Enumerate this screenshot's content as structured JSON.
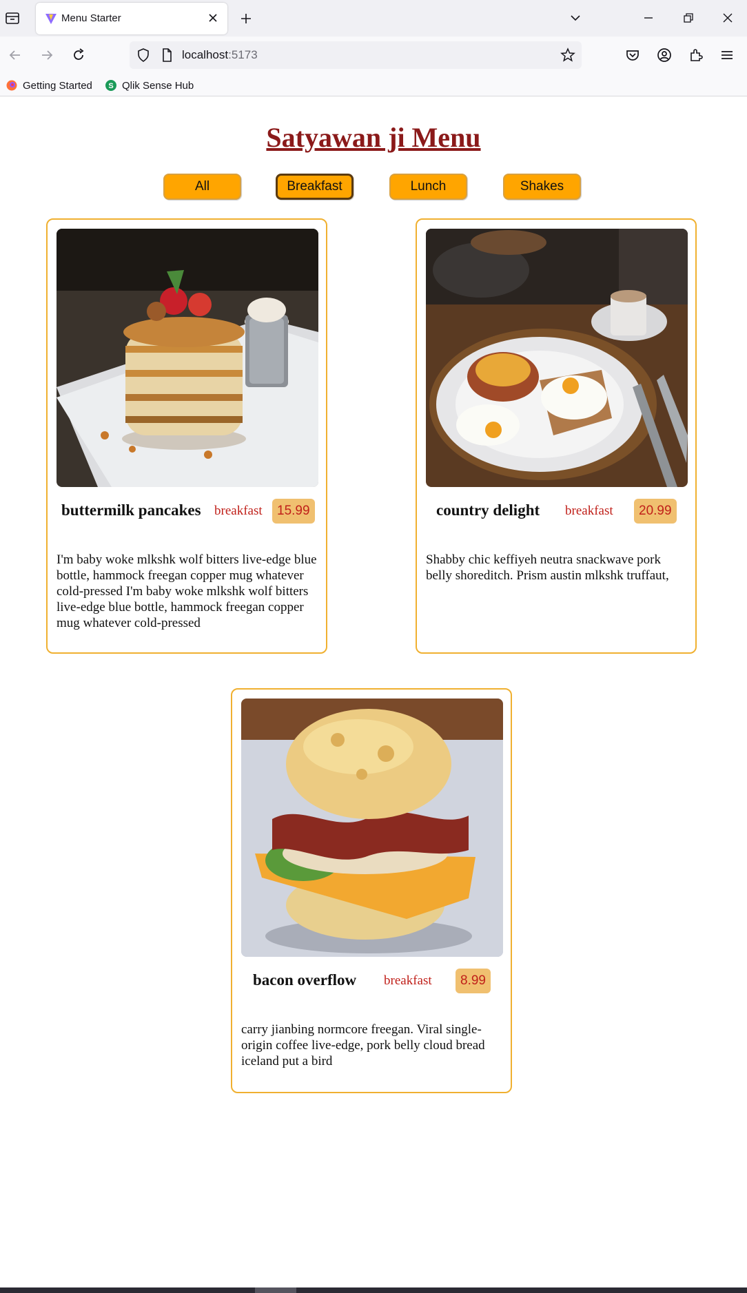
{
  "browser": {
    "tab_title": "Menu Starter",
    "url_host": "localhost",
    "url_port": ":5173",
    "bookmarks": [
      "Getting Started",
      "Qlik Sense Hub"
    ]
  },
  "page": {
    "title": "Satyawan ji Menu",
    "filters": [
      "All",
      "Breakfast",
      "Lunch",
      "Shakes"
    ],
    "active_filter": "Breakfast"
  },
  "items": [
    {
      "name": "buttermilk pancakes",
      "category": "breakfast",
      "price": "15.99",
      "image_icon": "pancakes-photo",
      "description": "I'm baby woke mlkshk wolf bitters live-edge blue bottle, hammock freegan copper mug whatever cold-pressed I'm baby woke mlkshk wolf bitters live-edge blue bottle, hammock freegan copper mug whatever cold-pressed"
    },
    {
      "name": "country delight",
      "category": "breakfast",
      "price": "20.99",
      "image_icon": "eggs-toast-photo",
      "description": "Shabby chic keffiyeh neutra snackwave pork belly shoreditch. Prism austin mlkshk truffaut,"
    },
    {
      "name": "bacon overflow",
      "category": "breakfast",
      "price": "8.99",
      "image_icon": "biscuit-sandwich-photo",
      "description": "carry jianbing normcore freegan. Viral single-origin coffee live-edge, pork belly cloud bread iceland put a bird"
    }
  ],
  "colors": {
    "title": "#8b1a1a",
    "button": "#ffa500",
    "card_border": "#f0b030",
    "price_bg": "#f0c070",
    "accent_red": "#c0201a"
  }
}
